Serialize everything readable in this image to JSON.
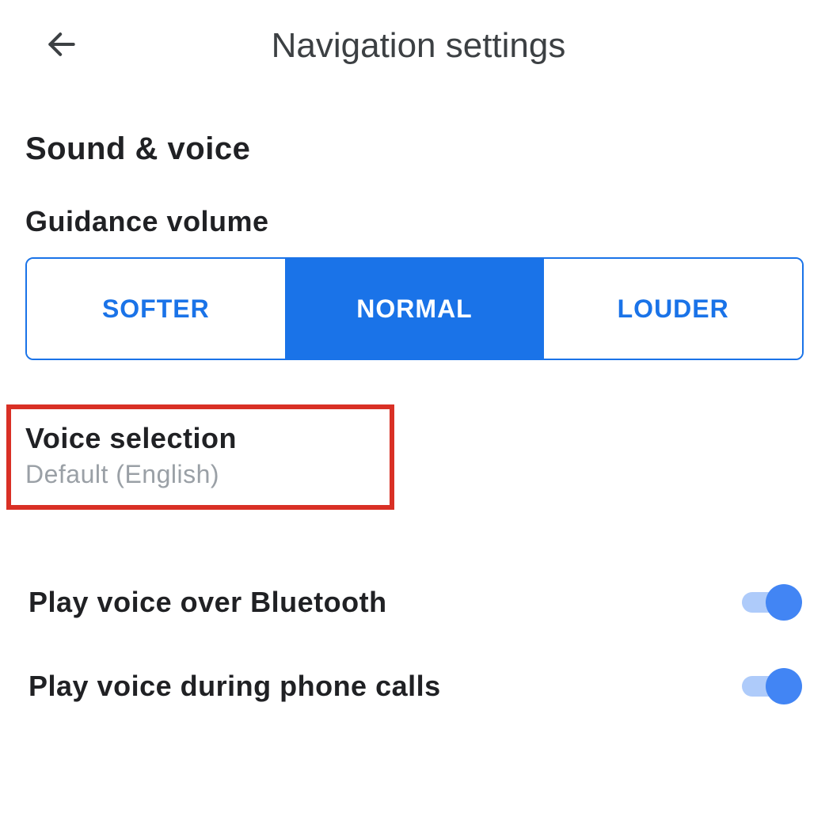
{
  "header": {
    "title": "Navigation settings"
  },
  "section": {
    "heading": "Sound & voice"
  },
  "guidance": {
    "label": "Guidance volume",
    "options": [
      "SOFTER",
      "NORMAL",
      "LOUDER"
    ],
    "selected_index": 1
  },
  "voice_selection": {
    "title": "Voice selection",
    "subtitle": "Default (English)"
  },
  "toggles": {
    "bluetooth": {
      "label": "Play voice over Bluetooth",
      "value": true
    },
    "phone_calls": {
      "label": "Play voice during phone calls",
      "value": true
    }
  }
}
